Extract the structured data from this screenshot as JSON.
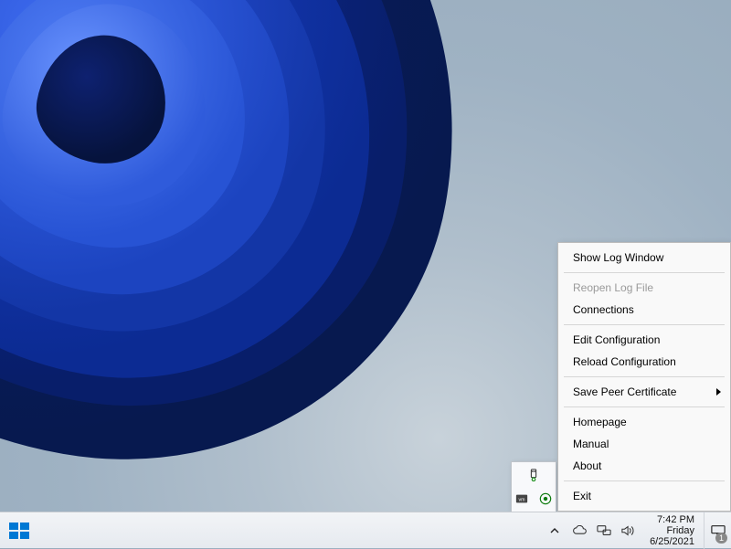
{
  "menu": {
    "show_log": "Show Log Window",
    "reopen_log": "Reopen Log File",
    "connections": "Connections",
    "edit_conf": "Edit Configuration",
    "reload_conf": "Reload Configuration",
    "save_cert": "Save Peer Certificate",
    "homepage": "Homepage",
    "manual": "Manual",
    "about": "About",
    "exit": "Exit"
  },
  "clock": {
    "time": "7:42 PM",
    "day": "Friday",
    "date": "6/25/2021"
  },
  "notifications_badge": "1"
}
